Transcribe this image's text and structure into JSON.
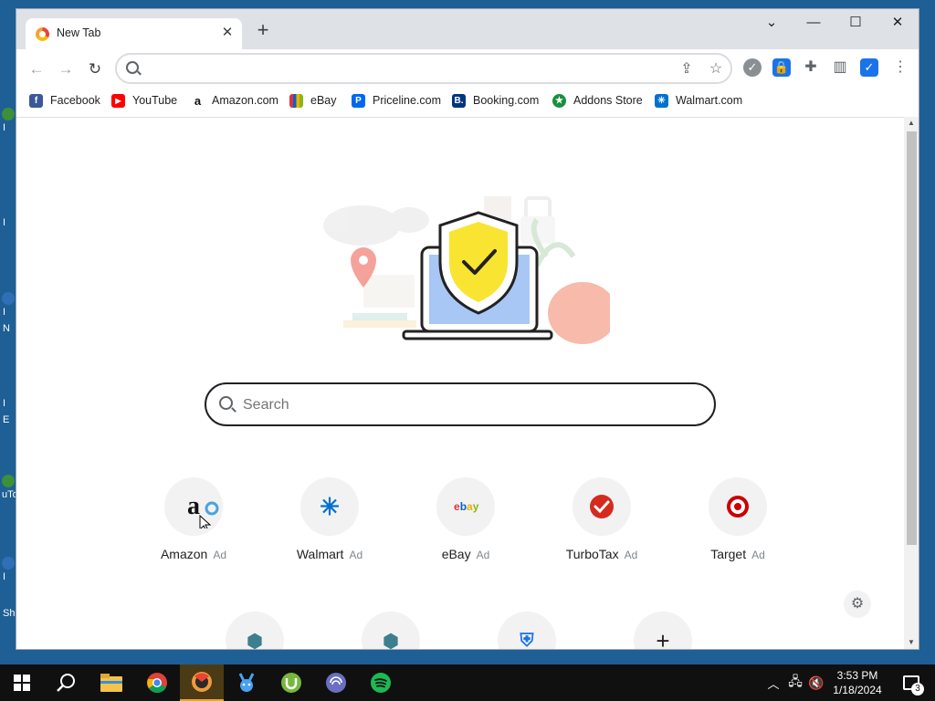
{
  "desktop": {
    "icon_labels": [
      "I",
      "I",
      "I",
      "N",
      "I",
      "E",
      "uTo",
      "I",
      "Sh"
    ]
  },
  "browser": {
    "tab_title": "New Tab",
    "window_controls": [
      "⌄",
      "—",
      "☐",
      "✕"
    ],
    "address_value": "",
    "bookmarks": [
      {
        "label": "Facebook",
        "icon": "facebook-icon",
        "color": "#3b5998",
        "glyph": "f"
      },
      {
        "label": "YouTube",
        "icon": "youtube-icon",
        "color": "#ff0000",
        "glyph": "▶"
      },
      {
        "label": "Amazon.com",
        "icon": "amazon-icon",
        "color": "#ffffff",
        "glyph": "a"
      },
      {
        "label": "eBay",
        "icon": "ebay-icon",
        "color": "#e53238",
        "glyph": ""
      },
      {
        "label": "Priceline.com",
        "icon": "priceline-icon",
        "color": "#0068ef",
        "glyph": "P"
      },
      {
        "label": "Booking.com",
        "icon": "booking-icon",
        "color": "#003580",
        "glyph": "B"
      },
      {
        "label": "Addons Store",
        "icon": "addons-store-icon",
        "color": "#1a8e3f",
        "glyph": "★"
      },
      {
        "label": "Walmart.com",
        "icon": "walmart-icon",
        "color": "#0071ce",
        "glyph": "✳"
      }
    ]
  },
  "newtab": {
    "search_placeholder": "Search",
    "tiles": [
      {
        "name": "Amazon",
        "ad": "Ad",
        "icon": "amazon-logo-icon",
        "glyph": "a",
        "color": "#111111"
      },
      {
        "name": "Walmart",
        "ad": "Ad",
        "icon": "walmart-logo-icon",
        "glyph": "✳",
        "color": "#0071ce"
      },
      {
        "name": "eBay",
        "ad": "Ad",
        "icon": "ebay-logo-icon",
        "glyph": "ebay",
        "color": "#e53238"
      },
      {
        "name": "TurboTax",
        "ad": "Ad",
        "icon": "turbotax-logo-icon",
        "glyph": "✔",
        "color": "#d52b1e"
      },
      {
        "name": "Target",
        "ad": "Ad",
        "icon": "target-logo-icon",
        "glyph": "◎",
        "color": "#cc0000"
      }
    ],
    "second_row_icons": [
      "cube-icon",
      "cube-icon",
      "shield-icon",
      "add-icon"
    ]
  },
  "taskbar": {
    "time": "3:53 PM",
    "date": "1/18/2024",
    "notification_count": "3"
  }
}
